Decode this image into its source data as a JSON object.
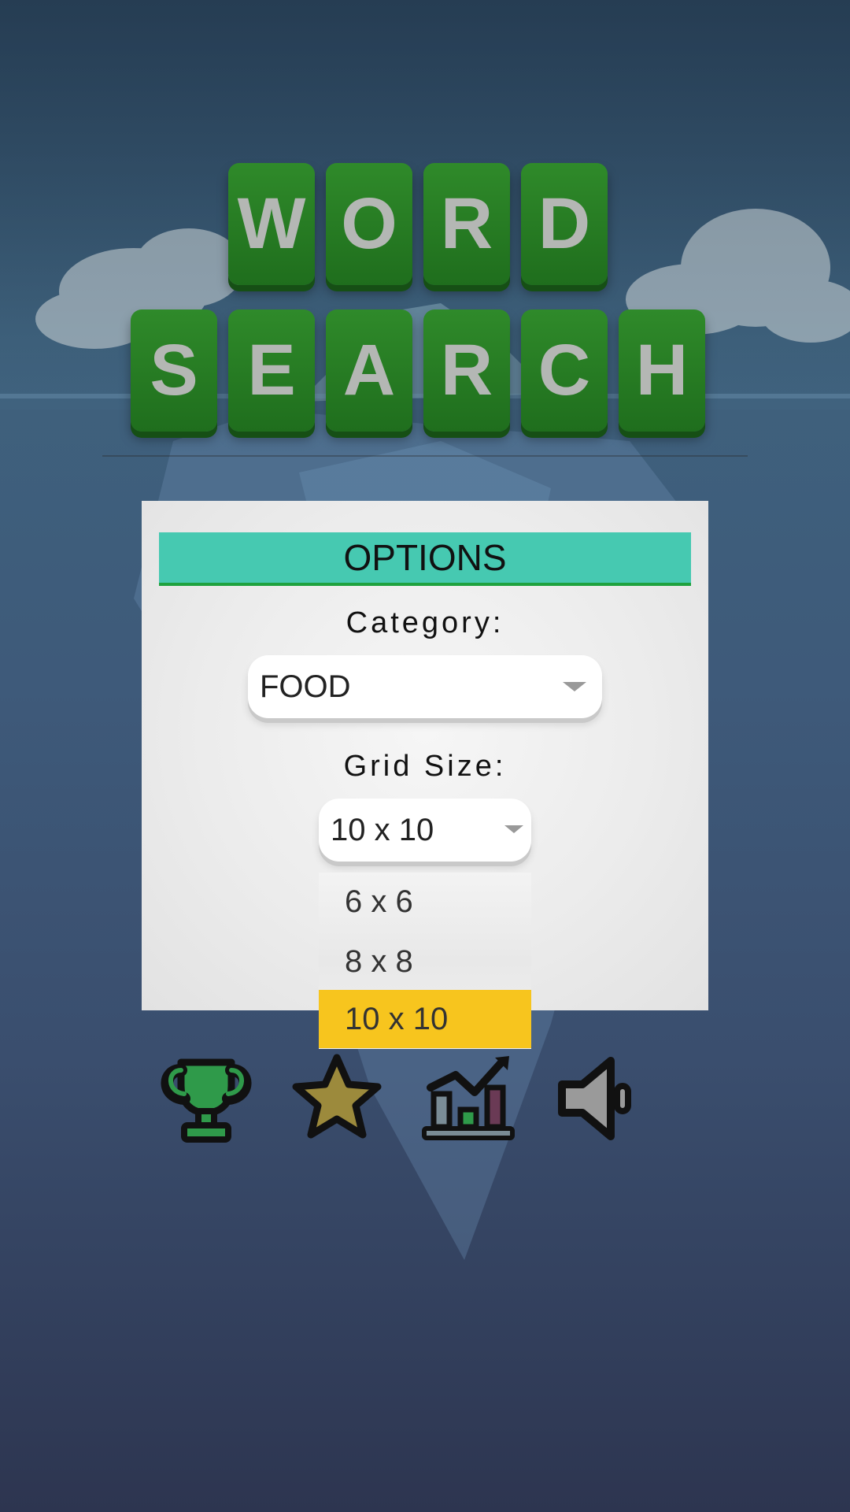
{
  "title": {
    "word1": [
      "W",
      "O",
      "R",
      "D"
    ],
    "word2": [
      "S",
      "E",
      "A",
      "R",
      "C",
      "H"
    ]
  },
  "options_panel": {
    "header": "OPTIONS",
    "category_label": "Category:",
    "category_value": "FOOD",
    "grid_size_label": "Grid Size:",
    "grid_size_value": "10 x 10",
    "grid_size_options": [
      "6 x 6",
      "8 x 8",
      "10 x 10"
    ],
    "grid_size_selected_index": 2
  },
  "bottom_icons": [
    "trophy-icon",
    "star-icon",
    "stats-chart-icon",
    "speaker-icon"
  ],
  "colors": {
    "tile_green": "#1f7a1f",
    "header_teal": "#46c9b1",
    "selected_yellow": "#f7c51e"
  }
}
